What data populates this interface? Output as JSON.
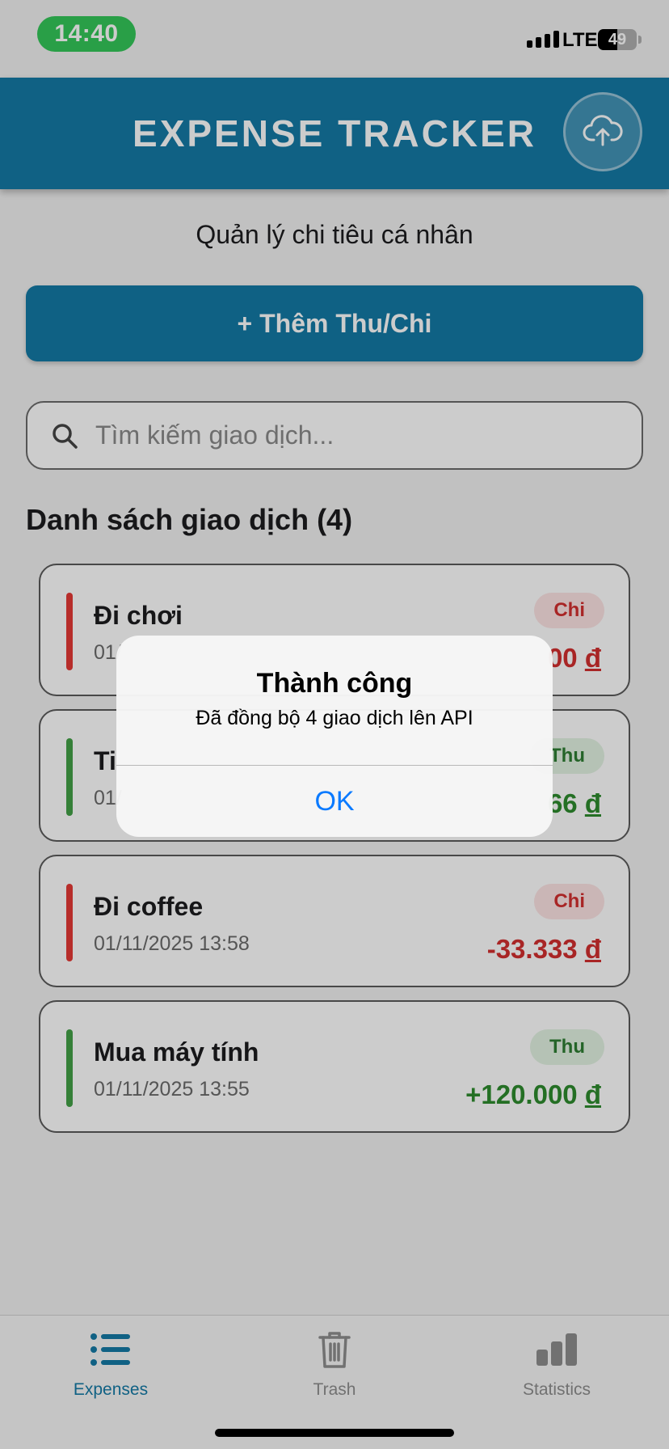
{
  "status_bar": {
    "time": "14:40",
    "network": "LTE",
    "battery": "49",
    "battery_level": 0.49
  },
  "header": {
    "title": "EXPENSE TRACKER",
    "sync_icon": "cloud-upload-icon"
  },
  "subtitle": "Quản lý chi tiêu cá nhân",
  "add_button": {
    "label": "+ Thêm Thu/Chi"
  },
  "search": {
    "placeholder": "Tìm kiếm giao dịch...",
    "value": "",
    "icon": "search-icon"
  },
  "list": {
    "title": "Danh sách giao dịch (4)",
    "items": [
      {
        "name": "Đi chơi",
        "date": "01/",
        "type": "Chi",
        "amount_visible": "00",
        "currency": "đ"
      },
      {
        "name": "Ti",
        "date": "01/",
        "type": "Thu",
        "amount_visible": "66",
        "currency": "đ"
      },
      {
        "name": "Đi coffee",
        "date": "01/11/2025 13:58",
        "type": "Chi",
        "amount_visible": "-33.333",
        "currency": "đ"
      },
      {
        "name": "Mua máy tính",
        "date": "01/11/2025 13:55",
        "type": "Thu",
        "amount_visible": "+120.000",
        "currency": "đ"
      }
    ]
  },
  "alert": {
    "title": "Thành công",
    "message": "Đã đồng bộ 4 giao dịch lên API",
    "ok_label": "OK"
  },
  "tabbar": {
    "tabs": [
      {
        "label": "Expenses",
        "icon": "list-icon",
        "active": true
      },
      {
        "label": "Trash",
        "icon": "trash-icon",
        "active": false
      },
      {
        "label": "Statistics",
        "icon": "bar-chart-icon",
        "active": false
      }
    ]
  },
  "colors": {
    "primary": "#157aa6",
    "expense": "#d32f2f",
    "income": "#2e7d32",
    "ios_blue": "#0a7aff",
    "status_green": "#34c759"
  }
}
